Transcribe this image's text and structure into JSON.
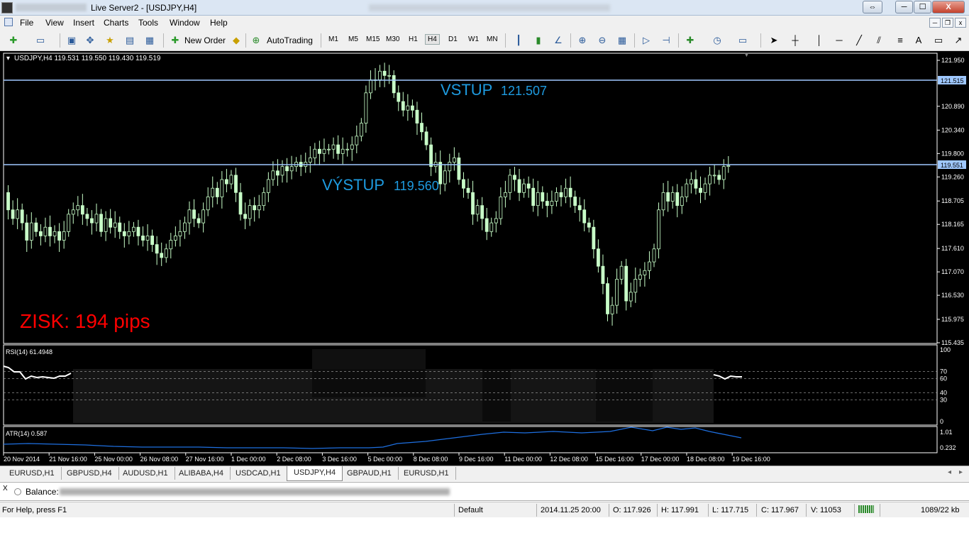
{
  "window": {
    "title": "Live Server2 - [USDJPY,H4]",
    "controls": {
      "restore": "⇔",
      "minimize": "─",
      "maximize": "☐",
      "close": "X"
    }
  },
  "menu": [
    "File",
    "View",
    "Insert",
    "Charts",
    "Tools",
    "Window",
    "Help"
  ],
  "toolbar": {
    "new_order": "New Order",
    "autotrading": "AutoTrading",
    "timeframes": [
      "M1",
      "M5",
      "M15",
      "M30",
      "H1",
      "H4",
      "D1",
      "W1",
      "MN"
    ],
    "active_timeframe": "H4",
    "text_tool": "A"
  },
  "chart": {
    "header": "USDJPY,H4  119.531 119.550 119.430 119.519",
    "entry_label": "VSTUP",
    "entry_value": "121.507",
    "exit_label": "VÝSTUP",
    "exit_value": "119.560",
    "profit_text": "ZISK: 194 pips",
    "price_ticks": [
      "121.950",
      "121.515",
      "120.890",
      "120.340",
      "119.800",
      "119.551",
      "119.260",
      "118.705",
      "118.165",
      "117.610",
      "117.070",
      "116.530",
      "115.975",
      "115.435"
    ],
    "hline_price_tag_1": "121.515",
    "hline_price_tag_2": "119.551",
    "rsi_header": "RSI(14) 61.4948",
    "rsi_ticks": [
      "100",
      "70",
      "60",
      "40",
      "30",
      "0"
    ],
    "atr_header": "ATR(14) 0.587",
    "atr_ticks": [
      "1.01",
      "0.232"
    ],
    "time_labels": [
      "20 Nov 2014",
      "21 Nov 16:00",
      "25 Nov 00:00",
      "26 Nov 08:00",
      "27 Nov 16:00",
      "1 Dec 00:00",
      "2 Dec 08:00",
      "3 Dec 16:00",
      "5 Dec 00:00",
      "8 Dec 08:00",
      "9 Dec 16:00",
      "11 Dec 00:00",
      "12 Dec 08:00",
      "15 Dec 16:00",
      "17 Dec 00:00",
      "18 Dec 08:00",
      "19 Dec 16:00"
    ],
    "colors": {
      "background": "#000000",
      "bull": "#c8ffc8",
      "bear": "#c8ffc8",
      "hline": "#9fc8ff",
      "label": "#1e9be0",
      "profit": "#ff0000",
      "atr": "#1e6fe0"
    }
  },
  "tabs": [
    "EURUSD,H1",
    "GBPUSD,H4",
    "AUDUSD,H1",
    "ALIBABA,H4",
    "USDCAD,H1",
    "USDJPY,H4",
    "GBPAUD,H1",
    "EURUSD,H1"
  ],
  "active_tab": "USDJPY,H4",
  "terminal": {
    "close": "X",
    "balance_label": "Balance:"
  },
  "status": {
    "help": "For Help, press F1",
    "profile": "Default",
    "datetime": "2014.11.25 20:00",
    "open": "O: 117.926",
    "high": "H: 117.991",
    "low": "L: 117.715",
    "close": "C: 117.967",
    "volume": "V: 11053",
    "traffic": "1089/22 kb"
  }
}
